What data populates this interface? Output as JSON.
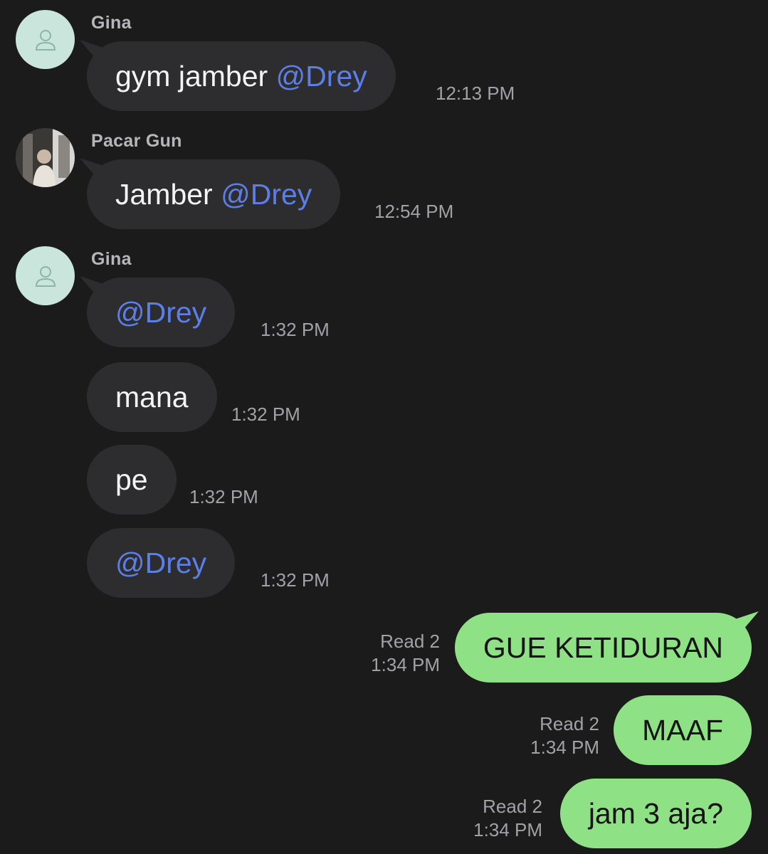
{
  "chat": {
    "groups": [
      {
        "sender": "Gina",
        "avatar": "default-avatar-icon"
      },
      {
        "sender": "Pacar Gun",
        "avatar": "photo-avatar"
      },
      {
        "sender": "Gina",
        "avatar": "default-avatar-icon"
      }
    ],
    "incoming": [
      {
        "text": "gym jamber ",
        "mention": "@Drey",
        "time": "12:13 PM"
      },
      {
        "text": "Jamber ",
        "mention": "@Drey",
        "time": "12:54 PM"
      },
      {
        "text": "",
        "mention": "@Drey",
        "time": "1:32 PM"
      },
      {
        "text": "mana",
        "mention": "",
        "time": "1:32 PM"
      },
      {
        "text": "pe",
        "mention": "",
        "time": "1:32 PM"
      },
      {
        "text": "",
        "mention": "@Drey",
        "time": "1:32 PM"
      }
    ],
    "outgoing": [
      {
        "text": "GUE KETIDURAN",
        "read": "Read 2",
        "time": "1:34 PM"
      },
      {
        "text": "MAAF",
        "read": "Read 2",
        "time": "1:34 PM"
      },
      {
        "text": "jam 3 aja?",
        "read": "Read 2",
        "time": "1:34 PM"
      }
    ]
  },
  "colors": {
    "background": "#1b1b1c",
    "incoming_bubble": "#2d2d2f",
    "outgoing_bubble": "#8ee185",
    "mention": "#5b7fe6",
    "avatar_default": "#c9e5dc"
  }
}
